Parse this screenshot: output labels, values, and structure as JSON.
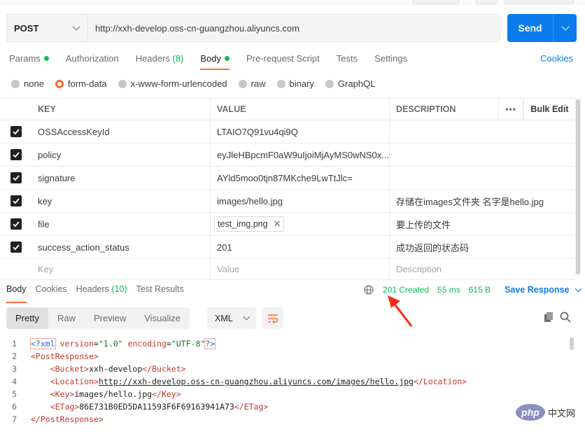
{
  "request": {
    "method": "POST",
    "url": "http://xxh-develop.oss-cn-guangzhou.aliyuncs.com",
    "send_label": "Send"
  },
  "req_tabs": [
    {
      "label": "Params",
      "dot": true
    },
    {
      "label": "Authorization"
    },
    {
      "label": "Headers",
      "count": "(8)"
    },
    {
      "label": "Body",
      "dot": true,
      "active": true
    },
    {
      "label": "Pre-request Script"
    },
    {
      "label": "Tests"
    },
    {
      "label": "Settings"
    }
  ],
  "cookies_label": "Cookies",
  "body_types": [
    "none",
    "form-data",
    "x-www-form-urlencoded",
    "raw",
    "binary",
    "GraphQL"
  ],
  "body_type_selected": "form-data",
  "table": {
    "headers": {
      "key": "KEY",
      "value": "VALUE",
      "description": "DESCRIPTION",
      "more": "•••",
      "bulk_edit": "Bulk Edit"
    },
    "rows": [
      {
        "key": "OSSAccessKeyId",
        "value": "LTAIO7Q91vu4qi9Q",
        "description": ""
      },
      {
        "key": "policy",
        "value": "eyJleHBpcmF0aW9uIjoiMjAyMS0wNS0x...",
        "description": ""
      },
      {
        "key": "signature",
        "value": "AYld5moo0tjn87MKche9LwTtJlc=",
        "description": ""
      },
      {
        "key": "key",
        "value": "images/hello.jpg",
        "description": "存储在images文件夹 名字是hello.jpg"
      },
      {
        "key": "file",
        "value": "test_img.png",
        "description": "要上传的文件",
        "file_remove": "✕"
      },
      {
        "key": "success_action_status",
        "value": "201",
        "description": "成功返回的状态码"
      }
    ],
    "placeholder": {
      "key": "Key",
      "value": "Value",
      "description": "Description"
    }
  },
  "response": {
    "tabs": [
      {
        "label": "Body",
        "active": true
      },
      {
        "label": "Cookies"
      },
      {
        "label": "Headers",
        "count": "(10)"
      },
      {
        "label": "Test Results"
      }
    ],
    "status": "201 Created",
    "time": "55 ms",
    "size": "615 B",
    "save_label": "Save Response",
    "view_tabs": [
      "Pretty",
      "Raw",
      "Preview",
      "Visualize"
    ],
    "view_selected": "Pretty",
    "format": "XML"
  },
  "code_lines": [
    {
      "n": "1"
    },
    {
      "n": "2"
    },
    {
      "n": "3"
    },
    {
      "n": "4"
    },
    {
      "n": "5"
    },
    {
      "n": "6"
    },
    {
      "n": "7"
    }
  ],
  "xml": {
    "declaration_open": "<?xml",
    "version_attr": "version",
    "version_val": "\"1.0\"",
    "encoding_attr": "encoding",
    "encoding_val": "\"UTF-8\"",
    "declaration_close": "?>",
    "post_open": "<PostResponse>",
    "bucket_open": "<Bucket>",
    "bucket": "xxh-develop",
    "bucket_close": "</Bucket>",
    "location_open": "<Location>",
    "location": "http://xxh-develop.oss-cn-guangzhou.aliyuncs.com/images/hello.jpg",
    "location_close": "</Location>",
    "key_open": "<Key>",
    "key": "images/hello.jpg",
    "key_close": "</Key>",
    "etag_open": "<ETag>",
    "etag": "86E731B0ED5DA11593F6F69163941A73",
    "etag_close": "</ETag>",
    "post_close": "</PostResponse>"
  },
  "watermark": {
    "badge": "php",
    "name": "中文网"
  },
  "colors": {
    "accent": "#ff6c37",
    "primary": "#097bed",
    "success": "#0cbb52"
  }
}
